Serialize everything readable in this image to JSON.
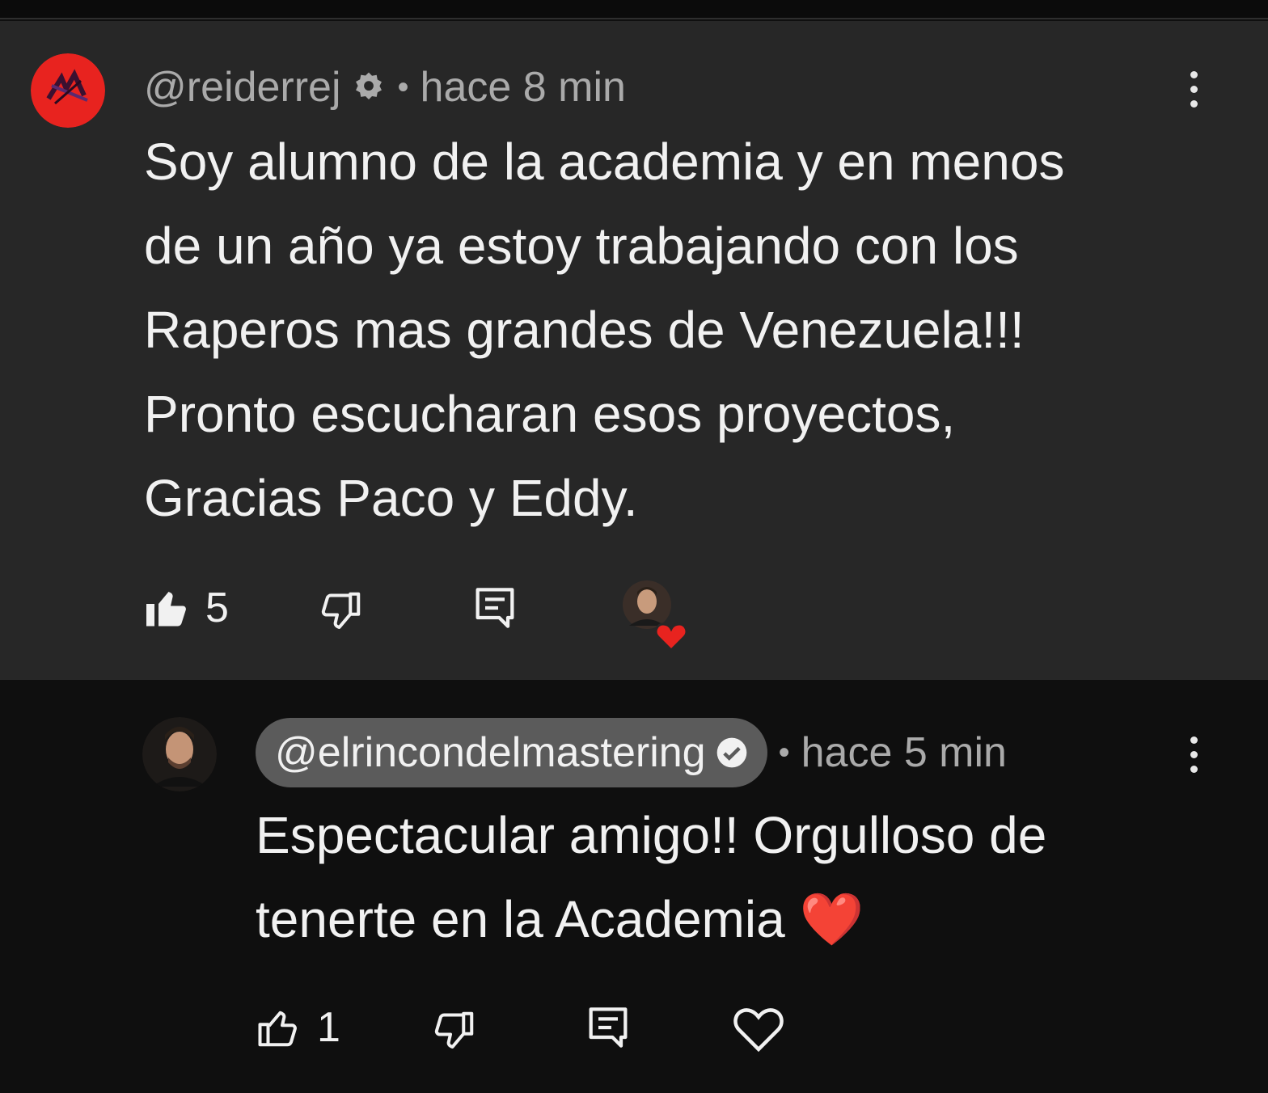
{
  "comment": {
    "handle": "@reiderrej",
    "separator": "•",
    "time": "hace 8 min",
    "text": "Soy alumno de la academia y en menos\nde un año ya estoy trabajando con los\nRaperos mas grandes de Venezuela!!!\nPronto escucharan esos proyectos,\nGracias Paco y Eddy.",
    "likes": "5",
    "avatar_color": "#e8231f"
  },
  "reply": {
    "handle": "@elrincondelmastering",
    "separator": "•",
    "time": "hace 5 min",
    "text": "Espectacular amigo!! Orgulloso de\ntenerte en la Academia ❤️",
    "likes": "1"
  },
  "colors": {
    "comment_bg": "#272727",
    "reply_bg": "#0f0f0f",
    "heart": "#e8231f",
    "pill": "#5b5b5b"
  }
}
